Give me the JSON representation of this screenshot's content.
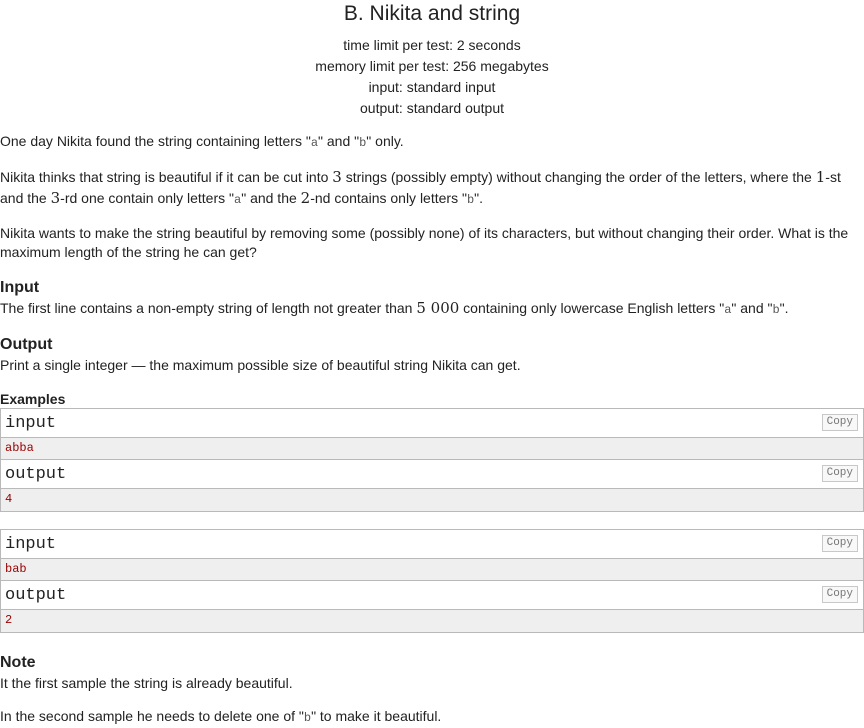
{
  "problem": {
    "title": "B. Nikita and string",
    "limits": {
      "time": "time limit per test: 2 seconds",
      "memory": "memory limit per test: 256 megabytes",
      "input": "input: standard input",
      "output": "output: standard output"
    }
  },
  "statement": {
    "p1": {
      "t1": "One day Nikita found the string containing letters \"",
      "c1": "a",
      "t2": "\" and \"",
      "c2": "b",
      "t3": "\" only."
    },
    "p2": {
      "t1": "Nikita thinks that string is beautiful if it can be cut into ",
      "m1": "3",
      "t2": " strings (possibly empty) without changing the order of the letters, where the ",
      "m2": "1",
      "t3": "-st and the ",
      "m3": "3",
      "t4": "-rd one contain only letters \"",
      "c1": "a",
      "t5": "\" and the ",
      "m4": "2",
      "t6": "-nd contains only letters \"",
      "c2": "b",
      "t7": "\"."
    },
    "p3": "Nikita wants to make the string beautiful by removing some (possibly none) of its characters, but without changing their order. What is the maximum length of the string he can get?"
  },
  "input_section": {
    "title": "Input",
    "t1": "The first line contains a non-empty string of length not greater than ",
    "m1": "5 000",
    "t2": " containing only lowercase English letters \"",
    "c1": "a",
    "t3": "\" and \"",
    "c2": "b",
    "t4": "\"."
  },
  "output_section": {
    "title": "Output",
    "text": "Print a single integer — the maximum possible size of beautiful string Nikita can get."
  },
  "examples": {
    "title": "Examples",
    "copy_label": "Copy",
    "items": [
      {
        "input_label": "input",
        "input": "abba",
        "output_label": "output",
        "output": "4"
      },
      {
        "input_label": "input",
        "input": "bab",
        "output_label": "output",
        "output": "2"
      }
    ]
  },
  "note": {
    "title": "Note",
    "line1": "It the first sample the string is already beautiful.",
    "line2_t1": "In the second sample he needs to delete one of \"",
    "line2_c1": "b",
    "line2_t2": "\" to make it beautiful."
  }
}
